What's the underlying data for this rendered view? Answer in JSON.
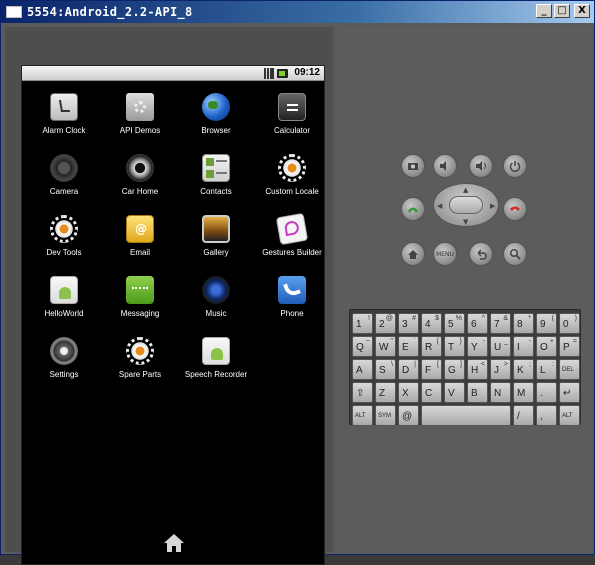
{
  "window": {
    "title": "5554:Android_2.2-API_8",
    "minimize": "_",
    "maximize": "□",
    "close": "X"
  },
  "status_bar": {
    "time": "09:12"
  },
  "apps": [
    {
      "label": "Alarm Clock",
      "icon": "alarm-clock-icon"
    },
    {
      "label": "API Demos",
      "icon": "folder-gear-icon"
    },
    {
      "label": "Browser",
      "icon": "globe-icon"
    },
    {
      "label": "Calculator",
      "icon": "calculator-icon"
    },
    {
      "label": "Camera",
      "icon": "camera-icon"
    },
    {
      "label": "Car Home",
      "icon": "car-icon"
    },
    {
      "label": "Contacts",
      "icon": "contacts-icon"
    },
    {
      "label": "Custom Locale",
      "icon": "gear-icon"
    },
    {
      "label": "Dev Tools",
      "icon": "gear-icon"
    },
    {
      "label": "Email",
      "icon": "email-icon"
    },
    {
      "label": "Gallery",
      "icon": "gallery-icon"
    },
    {
      "label": "Gestures Builder",
      "icon": "gestures-icon"
    },
    {
      "label": "HelloWorld",
      "icon": "android-icon"
    },
    {
      "label": "Messaging",
      "icon": "message-icon"
    },
    {
      "label": "Music",
      "icon": "speaker-icon"
    },
    {
      "label": "Phone",
      "icon": "phone-icon"
    },
    {
      "label": "Settings",
      "icon": "settings-icon"
    },
    {
      "label": "Spare Parts",
      "icon": "gear-icon"
    },
    {
      "label": "Speech Recorder",
      "icon": "android-icon"
    }
  ],
  "controls": {
    "menu": "MENU"
  },
  "keyboard": {
    "row1": [
      [
        "1",
        "!"
      ],
      [
        "2",
        "@"
      ],
      [
        "3",
        "#"
      ],
      [
        "4",
        "$"
      ],
      [
        "5",
        "%"
      ],
      [
        "6",
        "^"
      ],
      [
        "7",
        "&"
      ],
      [
        "8",
        "*"
      ],
      [
        "9",
        "("
      ],
      [
        "0",
        ")"
      ]
    ],
    "row2": [
      [
        "Q",
        "~"
      ],
      [
        "W",
        "\""
      ],
      [
        "E",
        "`"
      ],
      [
        "R",
        "{"
      ],
      [
        "T",
        "}"
      ],
      [
        "Y",
        "-"
      ],
      [
        "U",
        "_"
      ],
      [
        "I",
        "-"
      ],
      [
        "O",
        "+"
      ],
      [
        "P",
        "="
      ]
    ],
    "row3": [
      [
        "A",
        ""
      ],
      [
        "S",
        "\\"
      ],
      [
        "D",
        "|"
      ],
      [
        "F",
        "["
      ],
      [
        "G",
        "]"
      ],
      [
        "H",
        "<"
      ],
      [
        "J",
        ">"
      ],
      [
        "K",
        ";"
      ],
      [
        "L",
        ":"
      ],
      [
        "DEL",
        ""
      ]
    ],
    "row4": [
      [
        "⇧",
        ""
      ],
      [
        "Z",
        ""
      ],
      [
        "X",
        ""
      ],
      [
        "C",
        ""
      ],
      [
        "V",
        ""
      ],
      [
        "B",
        ""
      ],
      [
        "N",
        ""
      ],
      [
        "M",
        ""
      ],
      [
        ".",
        ""
      ],
      [
        "↵",
        ""
      ]
    ],
    "row5_labels": {
      "alt_left": "ALT",
      "sym": "SYM",
      "at": "@",
      "slash": "/",
      "comma": ",",
      "alt_right": "ALT"
    }
  }
}
